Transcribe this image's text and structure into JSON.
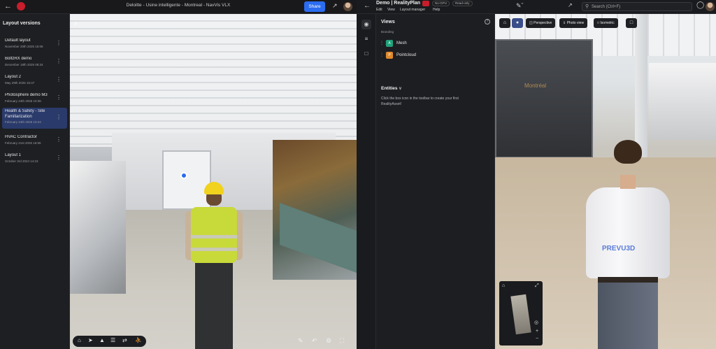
{
  "left_app": {
    "title": "Deloitte - Usine intelligente - Montreal - NavVis VLX",
    "share_label": "Share",
    "sidebar_title": "Layout versions",
    "layouts": [
      {
        "name": "Default layout",
        "date": "November 20th 2025 15:08"
      },
      {
        "name": "BoltzRX demo",
        "date": "December 18th 2025 08:34"
      },
      {
        "name": "Layout 2",
        "date": "May 29th 2025 15:47"
      },
      {
        "name": "Photosphere demo M3",
        "date": "February 24th 2025 10:36"
      },
      {
        "name": "Health & Safety - Site Familiarization",
        "date": "February 24th 2025 10:24",
        "active": true
      },
      {
        "name": "HVAC Contractor",
        "date": "February 21st 2025 16:55"
      },
      {
        "name": "Layout 1",
        "date": "October 3rd 2024 14:23"
      }
    ]
  },
  "right_app": {
    "title": "Demo | RealityPlan",
    "chips": [
      "No-GPU",
      "Read-only"
    ],
    "menu": [
      "Edit",
      "View",
      "Layout manager",
      "Help"
    ],
    "search_placeholder": "Search (Ctrl+F)",
    "panel": {
      "views_heading": "Views",
      "views_sub": "Branding",
      "items": [
        {
          "label": "Mesh",
          "badge": "A",
          "color": "#1fa37a"
        },
        {
          "label": "Pointcloud",
          "badge": "P",
          "color": "#e08a2b"
        }
      ],
      "entities_heading": "Entities",
      "entities_msg": "Click the box icon in the toolbar to create your first RealityAsset!"
    },
    "viewport_toolbar": [
      "Perspective",
      "Photo view",
      "Isometric"
    ],
    "scene_sign": "Montréal",
    "shirt_brand": "PREVU3D"
  }
}
